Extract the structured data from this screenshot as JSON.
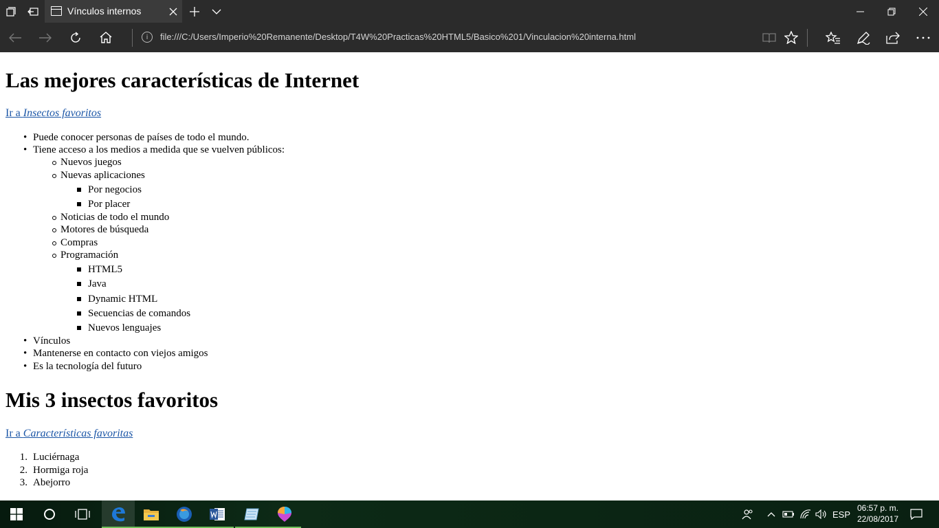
{
  "browser": {
    "tab_title": "Vínculos internos",
    "url": "file:///C:/Users/Imperio%20Remanente/Desktop/T4W%20Practicas%20HTML5/Basico%201/Vinculacion%20interna.html"
  },
  "page": {
    "heading1": "Las mejores características de Internet",
    "link1_prefix": "Ir a ",
    "link1_target": "Insectos favoritos",
    "features": [
      "Puede conocer personas de países de todo el mundo.",
      "Tiene acceso a los medios a medida que se vuelven públicos:",
      "Nuevos juegos",
      "Nuevas aplicaciones",
      "Por negocios",
      "Por placer",
      "Noticias de todo el mundo",
      "Motores de búsqueda",
      "Compras",
      "Programación",
      "HTML5",
      "Java",
      "Dynamic HTML",
      "Secuencias de comandos",
      "Nuevos lenguajes",
      "Vínculos",
      "Mantenerse en contacto con viejos amigos",
      "Es la tecnología del futuro"
    ],
    "heading2": "Mis 3 insectos favoritos",
    "link2_prefix": "Ir a ",
    "link2_target": "Características favoritas",
    "insects": [
      "Luciérnaga",
      "Hormiga roja",
      "Abejorro"
    ],
    "insect_numbers": [
      "1.",
      "2.",
      "3."
    ]
  },
  "taskbar": {
    "language": "ESP",
    "time": "06:57 p. m.",
    "date": "22/08/2017"
  },
  "colors": {
    "chrome_dark": "#2b2b2b",
    "tab_active": "#3b3b3b",
    "link": "#1a55a6",
    "edge_blue": "#1e78d7"
  }
}
